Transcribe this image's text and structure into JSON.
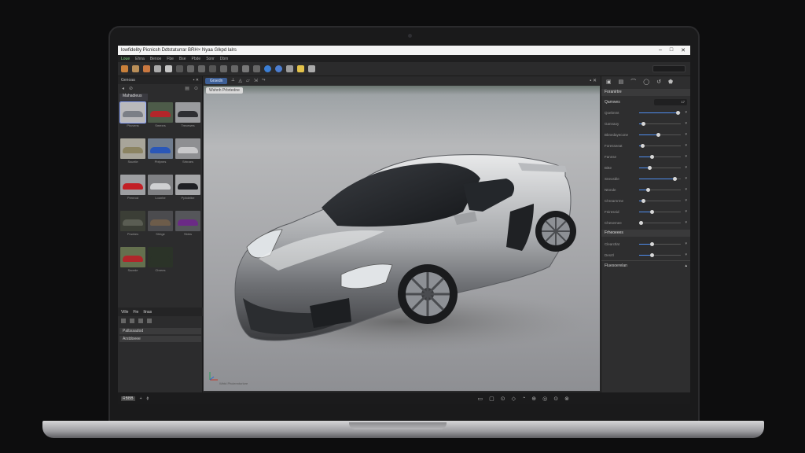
{
  "window": {
    "title": "lowfidelity  Picnicsh  Ddtstaturrar  BRH×  Nyaa  Glkpd lalrs",
    "controls": [
      "–",
      "□",
      "✕"
    ]
  },
  "menu": [
    "Loue",
    "Ehna",
    "Benoe",
    "Fbe",
    "Bse",
    "Pbde",
    "Sonr",
    "Dbm"
  ],
  "left_panel": {
    "title": "Genoaa",
    "folder": "Mahadieus",
    "thumbnails": [
      {
        "label": "Phcvens",
        "color": "#7b7f86",
        "bg": "#b9b9bb"
      },
      {
        "label": "Smexrs",
        "color": "#b3262a",
        "bg": "#4d5b49"
      },
      {
        "label": "Trecewes",
        "color": "#2e2f33",
        "bg": "#9a9b9e"
      },
      {
        "label": "Ssueiie",
        "color": "#8c8462",
        "bg": "#a8a59a"
      },
      {
        "label": "Pbfpnes",
        "color": "#2a57b8",
        "bg": "#6f7c8e"
      },
      {
        "label": "Srbraes",
        "color": "#c8c8ca",
        "bg": "#8e8f92"
      },
      {
        "label": "Prenrod",
        "color": "#c21f25",
        "bg": "#9e9fa2"
      },
      {
        "label": "Loonhe",
        "color": "#cfd0d2",
        "bg": "#808184"
      },
      {
        "label": "Ppbdelbe",
        "color": "#1f2024",
        "bg": "#a5a6a8"
      },
      {
        "label": "Pnwbes",
        "color": "#5a5d53",
        "bg": "#3b3e36"
      },
      {
        "label": "Shhge",
        "color": "#6d5c4a",
        "bg": "#4b4b4e"
      },
      {
        "label": "Sbles",
        "color": "#6b2a86",
        "bg": "#55565a"
      },
      {
        "label": "Saorde",
        "color": "#b0262a",
        "bg": "#64704e"
      },
      {
        "label": "Cbrees",
        "color": "#2b3328",
        "bg": "#2b3328"
      }
    ],
    "layers_header": [
      "Ville",
      "Fie",
      "Itnas"
    ],
    "layers": [
      "Palbssadod",
      "Arstdoeee"
    ],
    "status": [
      "RBDB",
      "+",
      "—"
    ]
  },
  "viewport": {
    "tab_label": "Grsedn",
    "overlay_label": "Wshnh Prbrtedne",
    "status": "Wbtd Phclenntorlore"
  },
  "right_panel": {
    "section1": "Foranirtre",
    "field": {
      "label": "Qamwes",
      "value": "17"
    },
    "sliders": [
      {
        "label": "Qoebnmt",
        "value": 0.92
      },
      {
        "label": "Gannaoy",
        "value": 0.1
      },
      {
        "label": "Bbnedayecone",
        "value": 0.45
      },
      {
        "label": "Foresseeat",
        "value": 0.08
      },
      {
        "label": "Fannse",
        "value": 0.3
      },
      {
        "label": "Bitte",
        "value": 0.25
      },
      {
        "label": "Sneosble",
        "value": 0.85
      },
      {
        "label": "Ntnnde",
        "value": 0.2
      },
      {
        "label": "Chrearnrme",
        "value": 0.1
      },
      {
        "label": "Fniresnid",
        "value": 0.3
      },
      {
        "label": "Chesemee",
        "value": 0.05
      }
    ],
    "section2": "Frheoeees",
    "sliders2": [
      {
        "label": "Clearctlat",
        "value": 0.3
      },
      {
        "label": "Desrtl",
        "value": 0.3
      }
    ],
    "footer": "Fluesoerelan"
  },
  "bottom_bar": {
    "left": [
      "RBBB",
      "+",
      "ɸ"
    ],
    "right_icons": [
      "▭",
      "▢",
      "⊙",
      "◇",
      "◔",
      "⊕",
      "◎",
      "⊙",
      "⊗"
    ]
  }
}
